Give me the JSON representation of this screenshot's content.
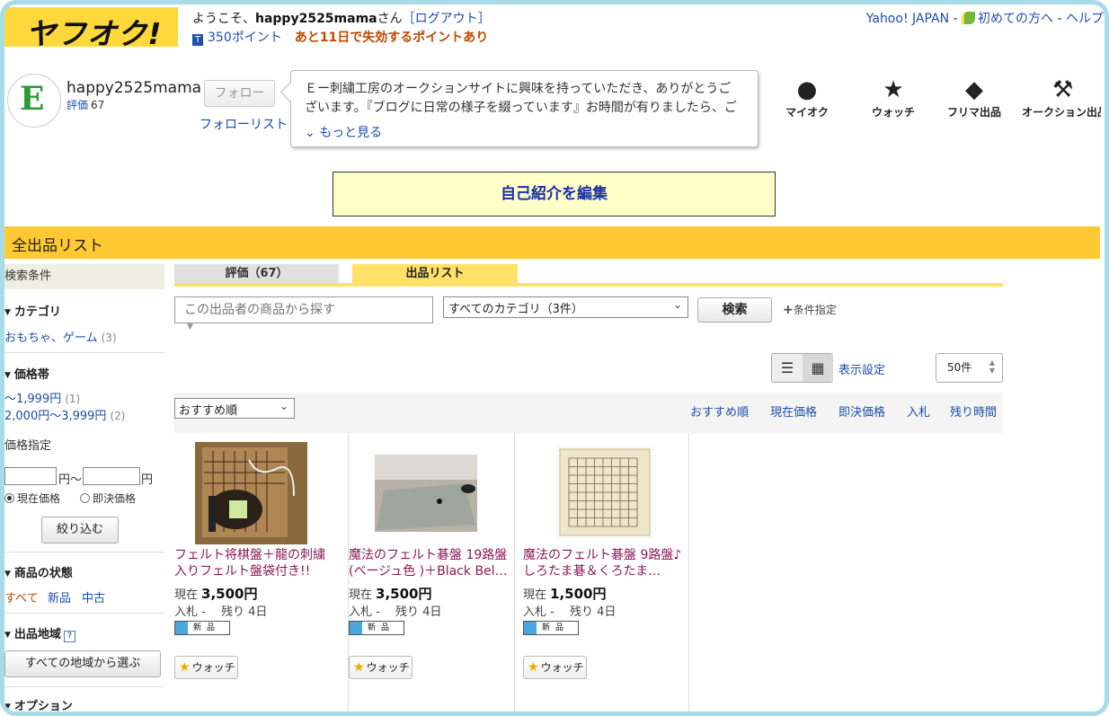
{
  "header": {
    "logo": "ヤフオク!",
    "welcome_prefix": "ようこそ、",
    "username": "happy2525mama",
    "welcome_suffix": "さん",
    "logout": "［ログアウト］",
    "points": "350ポイント",
    "points_warning": "あと11日で失効するポイントあり",
    "yahoo_japan": "Yahoo! JAPAN",
    "sep": "-",
    "first_time": "初めての方へ",
    "help": "ヘルプ"
  },
  "profile": {
    "avatar_letter": "E",
    "name": "happy2525mama",
    "rating_label": "評価",
    "rating_value": "67",
    "follow_button": "フォロー",
    "follow_list": "フォローリスト",
    "intro_text": "Ｅー刺繍工房のオークションサイトに興味を持っていただき、ありがとうございます。『ブログに日常の様子を綴っています』お時間が有りましたら、ご覧",
    "more": "もっと見る",
    "edit_intro": "自己紹介を編集"
  },
  "nav": {
    "myauc": "マイオク",
    "watch": "ウォッチ",
    "flea": "フリマ出品",
    "auction": "オークション出品"
  },
  "band_title": "全出品リスト",
  "sidebar": {
    "header": "検索条件",
    "category_title": "カテゴリ",
    "category_item": "おもちゃ、ゲーム",
    "category_count": "(3)",
    "price_title": "価格帯",
    "price_ranges": [
      {
        "label": "～1,999円",
        "count": "(1)"
      },
      {
        "label": "2,000円～3,999円",
        "count": "(2)"
      }
    ],
    "price_specify": "価格指定",
    "yen_tilde": "円～",
    "yen": "円",
    "radio_current": "現在価格",
    "radio_buynow": "即決価格",
    "narrow_button": "絞り込む",
    "condition_title": "商品の状態",
    "cond_all": "すべて",
    "cond_new": "新品",
    "cond_used": "中古",
    "region_title": "出品地域",
    "region_button": "すべての地域から選ぶ",
    "option_title": "オプション"
  },
  "tabs": {
    "rating": "評価（67）",
    "listing": "出品リスト"
  },
  "search": {
    "placeholder": "この出品者の商品から探す",
    "category_select": "すべてのカテゴリ（3件）",
    "button": "検索",
    "condition": "条件指定"
  },
  "view": {
    "display_settings": "表示設定",
    "per_page": "50件"
  },
  "sort": {
    "selected": "おすすめ順",
    "links": [
      "おすすめ順",
      "現在価格",
      "即決価格",
      "入札",
      "残り時間"
    ]
  },
  "items": [
    {
      "title": "フェルト将棋盤＋龍の刺繍入りフェルト盤袋付き!!",
      "price_label": "現在",
      "price": "3,500円",
      "bids": "入札 -",
      "remaining": "残り 4日",
      "badge": "新品",
      "watch": "ウォッチ"
    },
    {
      "title": "魔法のフェルト碁盤 19路盤(ベージュ色 )＋Black Bel…",
      "price_label": "現在",
      "price": "3,500円",
      "bids": "入札 -",
      "remaining": "残り 4日",
      "badge": "新品",
      "watch": "ウォッチ"
    },
    {
      "title": "魔法のフェルト碁盤 9路盤♪　しろたま碁＆くろたま…",
      "price_label": "現在",
      "price": "1,500円",
      "bids": "入札 -",
      "remaining": "残り 4日",
      "badge": "新品",
      "watch": "ウォッチ"
    }
  ],
  "colors": {
    "brand_yellow": "#ffc933",
    "link_blue": "#1a4fa8",
    "item_title": "#8a1a55",
    "frame": "#a7dbe8"
  }
}
